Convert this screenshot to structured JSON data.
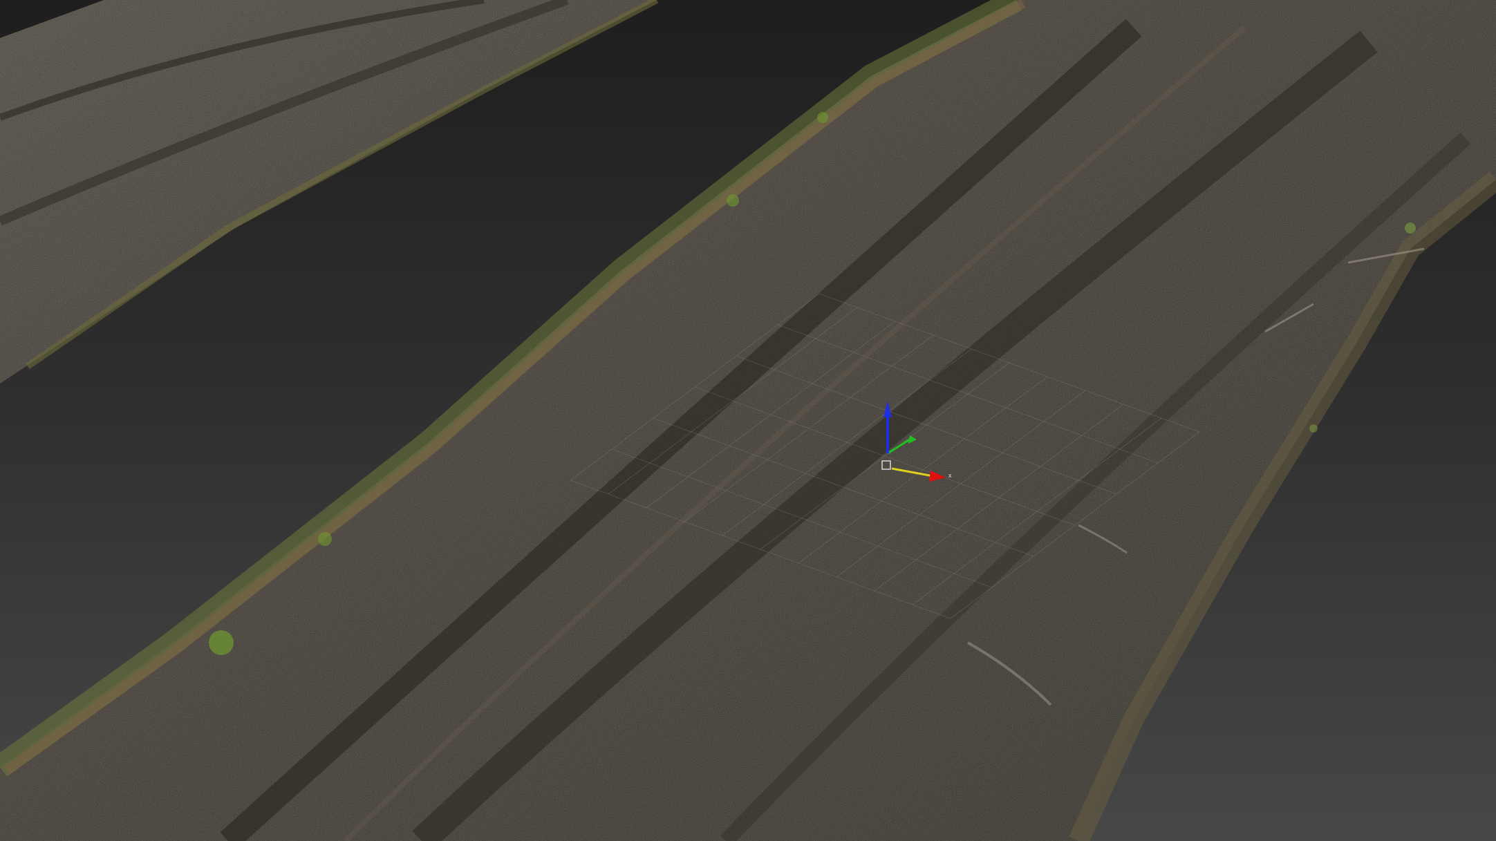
{
  "viewport": {
    "background_top": "#1e1e1e",
    "background_bottom": "#474747"
  },
  "mesh": {
    "soil_color": "#3e3a33",
    "moss_color": "#7a9a3a",
    "leaf_litter_color": "#7a6248"
  },
  "gizmo": {
    "x_label": "x",
    "x_color": "#e01010",
    "y_color": "#20c020",
    "z_color": "#2030e0",
    "pivot_color": "#e0d020"
  }
}
